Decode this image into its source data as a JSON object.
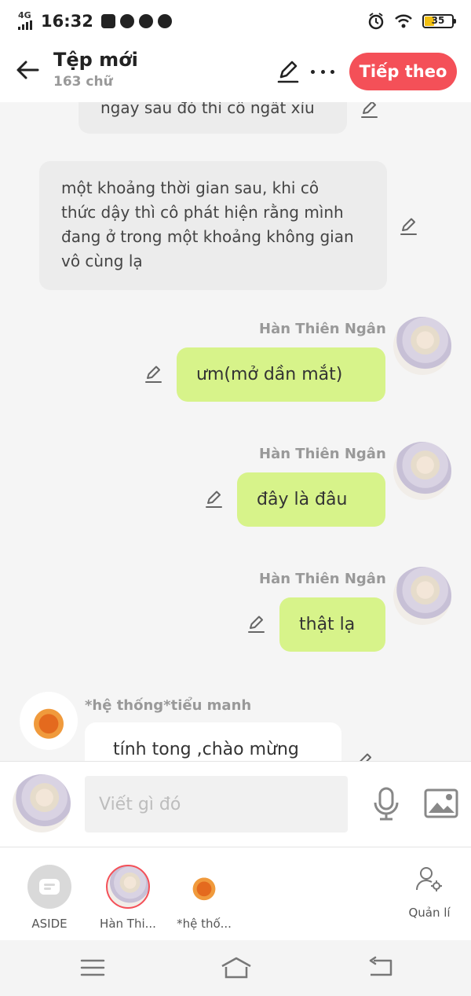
{
  "status_bar": {
    "network": "4G",
    "time": "16:32",
    "battery": "35"
  },
  "header": {
    "title": "Tệp mới",
    "word_count": "163 chữ",
    "next_button": "Tiếp theo"
  },
  "messages": {
    "narr1": "ngay sau đó thì cô ngất xỉu",
    "narr2_lines": [
      "một khoảng thời gian sau, khi cô",
      "thức dậy thì cô phát hiện rằng mình",
      "đang ở trong một khoảng không gian",
      "vô cùng lạ"
    ],
    "me1": {
      "sender": "Hàn Thiên Ngân",
      "text": "ưm(mở dần mắt)"
    },
    "me2": {
      "sender": "Hàn Thiên Ngân",
      "text": "đây là đâu"
    },
    "me3": {
      "sender": "Hàn Thiên Ngân",
      "text": "thật lạ"
    },
    "sys1": {
      "sender": "*hệ thống*tiểu manh",
      "text": "tính tong ,chào mừng"
    }
  },
  "composer": {
    "placeholder": "Viết gì đó"
  },
  "characters": [
    {
      "label": "ASIDE"
    },
    {
      "label": "Hàn Thi..."
    },
    {
      "label": "*hệ thố..."
    }
  ],
  "manage": {
    "label": "Quản lí"
  },
  "colors": {
    "accent": "#f45058",
    "my_bubble": "#d7f38a",
    "narration_bubble": "#ececec"
  }
}
